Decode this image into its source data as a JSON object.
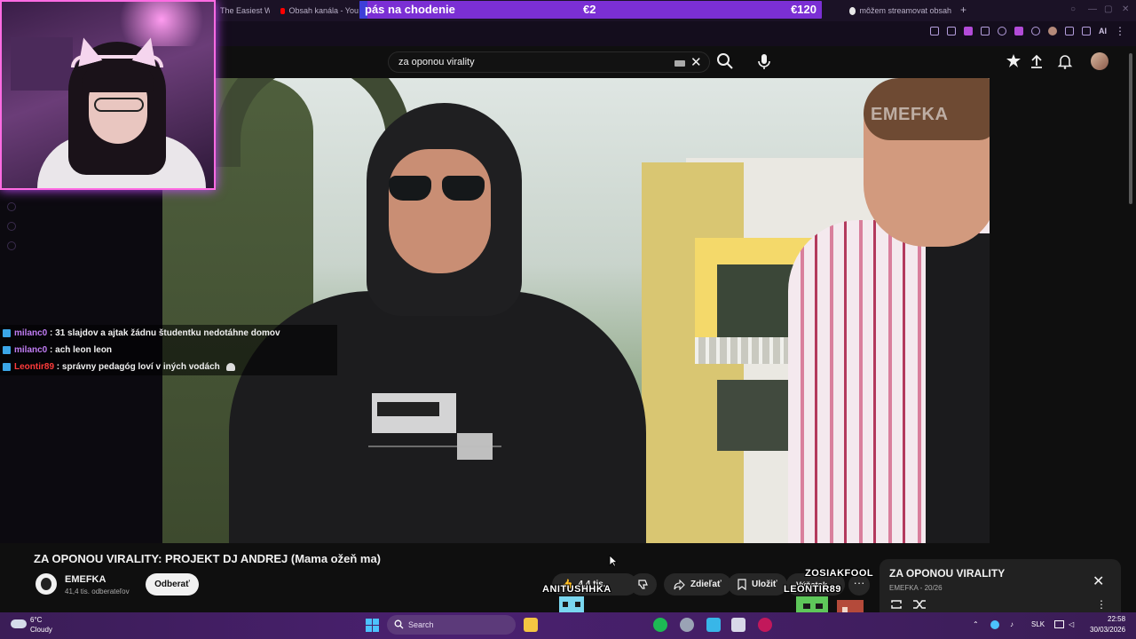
{
  "browser": {
    "tabs": [
      {
        "title": "The Easiest W"
      },
      {
        "title": "Obsah kanála - You"
      },
      {
        "title": "môžem streamovat obsah"
      }
    ],
    "ext_ai_label": "AI"
  },
  "donation_goal": {
    "label": "pás na chodenie",
    "current": "€2",
    "target": "€120",
    "progress_fraction": 0.0167
  },
  "search": {
    "query": "za oponou virality"
  },
  "video": {
    "watermark": "EMEFKA",
    "title": "ZA OPONOU VIRALITY: PROJEKT DJ ANDREJ (Mama ožeň ma)",
    "channel": "EMEFKA",
    "subscribers": "41,4 tis. odberateľov",
    "subscribe_label": "Odberať",
    "like_count": "4,4 tis.",
    "share_label": "Zdieľať",
    "save_label": "Uložiť",
    "clip_label": "Výňatok"
  },
  "playlist": {
    "title": "ZA OPONOU VIRALITY",
    "meta": "EMEFKA - 20/26"
  },
  "chat": [
    {
      "user": "milanc0",
      "message": ": 31 slajdov a ajtak žádnu študentku nedotáhne domov",
      "color": "#c07cf3"
    },
    {
      "user": "milanc0",
      "message": ": ach leon leon",
      "color": "#c07cf3"
    },
    {
      "user": "Leontir89",
      "message": ": správny pedagóg loví v iných vodách",
      "color": "#ff3b3b"
    }
  ],
  "pets": [
    {
      "name": "ANITUSHHKA"
    },
    {
      "name": "ZOSIAKFOOL"
    },
    {
      "name": "LEONTIR89"
    }
  ],
  "taskbar": {
    "weather_temp": "6°C",
    "weather_cond": "Cloudy",
    "search_placeholder": "Search",
    "language": "SLK",
    "time": "22:58",
    "date": "30/03/2026"
  },
  "colors": {
    "goal_bar": "#7b2fd4",
    "goal_fill": "#3e3fd8",
    "cam_border": "#ff6be3",
    "taskbar": "#4a2070"
  }
}
